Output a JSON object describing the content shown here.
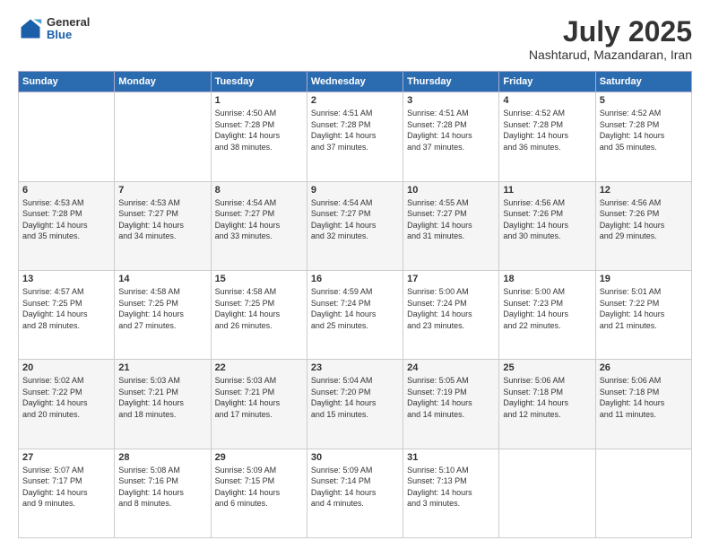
{
  "header": {
    "logo_general": "General",
    "logo_blue": "Blue",
    "month_year": "July 2025",
    "location": "Nashtarud, Mazandaran, Iran"
  },
  "days_of_week": [
    "Sunday",
    "Monday",
    "Tuesday",
    "Wednesday",
    "Thursday",
    "Friday",
    "Saturday"
  ],
  "weeks": [
    [
      {
        "day": "",
        "info": ""
      },
      {
        "day": "",
        "info": ""
      },
      {
        "day": "1",
        "info": "Sunrise: 4:50 AM\nSunset: 7:28 PM\nDaylight: 14 hours\nand 38 minutes."
      },
      {
        "day": "2",
        "info": "Sunrise: 4:51 AM\nSunset: 7:28 PM\nDaylight: 14 hours\nand 37 minutes."
      },
      {
        "day": "3",
        "info": "Sunrise: 4:51 AM\nSunset: 7:28 PM\nDaylight: 14 hours\nand 37 minutes."
      },
      {
        "day": "4",
        "info": "Sunrise: 4:52 AM\nSunset: 7:28 PM\nDaylight: 14 hours\nand 36 minutes."
      },
      {
        "day": "5",
        "info": "Sunrise: 4:52 AM\nSunset: 7:28 PM\nDaylight: 14 hours\nand 35 minutes."
      }
    ],
    [
      {
        "day": "6",
        "info": "Sunrise: 4:53 AM\nSunset: 7:28 PM\nDaylight: 14 hours\nand 35 minutes."
      },
      {
        "day": "7",
        "info": "Sunrise: 4:53 AM\nSunset: 7:27 PM\nDaylight: 14 hours\nand 34 minutes."
      },
      {
        "day": "8",
        "info": "Sunrise: 4:54 AM\nSunset: 7:27 PM\nDaylight: 14 hours\nand 33 minutes."
      },
      {
        "day": "9",
        "info": "Sunrise: 4:54 AM\nSunset: 7:27 PM\nDaylight: 14 hours\nand 32 minutes."
      },
      {
        "day": "10",
        "info": "Sunrise: 4:55 AM\nSunset: 7:27 PM\nDaylight: 14 hours\nand 31 minutes."
      },
      {
        "day": "11",
        "info": "Sunrise: 4:56 AM\nSunset: 7:26 PM\nDaylight: 14 hours\nand 30 minutes."
      },
      {
        "day": "12",
        "info": "Sunrise: 4:56 AM\nSunset: 7:26 PM\nDaylight: 14 hours\nand 29 minutes."
      }
    ],
    [
      {
        "day": "13",
        "info": "Sunrise: 4:57 AM\nSunset: 7:25 PM\nDaylight: 14 hours\nand 28 minutes."
      },
      {
        "day": "14",
        "info": "Sunrise: 4:58 AM\nSunset: 7:25 PM\nDaylight: 14 hours\nand 27 minutes."
      },
      {
        "day": "15",
        "info": "Sunrise: 4:58 AM\nSunset: 7:25 PM\nDaylight: 14 hours\nand 26 minutes."
      },
      {
        "day": "16",
        "info": "Sunrise: 4:59 AM\nSunset: 7:24 PM\nDaylight: 14 hours\nand 25 minutes."
      },
      {
        "day": "17",
        "info": "Sunrise: 5:00 AM\nSunset: 7:24 PM\nDaylight: 14 hours\nand 23 minutes."
      },
      {
        "day": "18",
        "info": "Sunrise: 5:00 AM\nSunset: 7:23 PM\nDaylight: 14 hours\nand 22 minutes."
      },
      {
        "day": "19",
        "info": "Sunrise: 5:01 AM\nSunset: 7:22 PM\nDaylight: 14 hours\nand 21 minutes."
      }
    ],
    [
      {
        "day": "20",
        "info": "Sunrise: 5:02 AM\nSunset: 7:22 PM\nDaylight: 14 hours\nand 20 minutes."
      },
      {
        "day": "21",
        "info": "Sunrise: 5:03 AM\nSunset: 7:21 PM\nDaylight: 14 hours\nand 18 minutes."
      },
      {
        "day": "22",
        "info": "Sunrise: 5:03 AM\nSunset: 7:21 PM\nDaylight: 14 hours\nand 17 minutes."
      },
      {
        "day": "23",
        "info": "Sunrise: 5:04 AM\nSunset: 7:20 PM\nDaylight: 14 hours\nand 15 minutes."
      },
      {
        "day": "24",
        "info": "Sunrise: 5:05 AM\nSunset: 7:19 PM\nDaylight: 14 hours\nand 14 minutes."
      },
      {
        "day": "25",
        "info": "Sunrise: 5:06 AM\nSunset: 7:18 PM\nDaylight: 14 hours\nand 12 minutes."
      },
      {
        "day": "26",
        "info": "Sunrise: 5:06 AM\nSunset: 7:18 PM\nDaylight: 14 hours\nand 11 minutes."
      }
    ],
    [
      {
        "day": "27",
        "info": "Sunrise: 5:07 AM\nSunset: 7:17 PM\nDaylight: 14 hours\nand 9 minutes."
      },
      {
        "day": "28",
        "info": "Sunrise: 5:08 AM\nSunset: 7:16 PM\nDaylight: 14 hours\nand 8 minutes."
      },
      {
        "day": "29",
        "info": "Sunrise: 5:09 AM\nSunset: 7:15 PM\nDaylight: 14 hours\nand 6 minutes."
      },
      {
        "day": "30",
        "info": "Sunrise: 5:09 AM\nSunset: 7:14 PM\nDaylight: 14 hours\nand 4 minutes."
      },
      {
        "day": "31",
        "info": "Sunrise: 5:10 AM\nSunset: 7:13 PM\nDaylight: 14 hours\nand 3 minutes."
      },
      {
        "day": "",
        "info": ""
      },
      {
        "day": "",
        "info": ""
      }
    ]
  ]
}
